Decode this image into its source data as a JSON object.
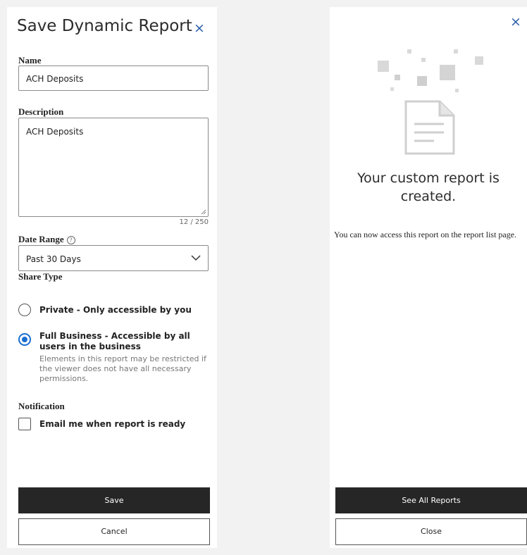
{
  "save_dialog": {
    "title": "Save Dynamic Report",
    "close_icon": "close-icon",
    "name": {
      "label": "Name",
      "value": "ACH Deposits"
    },
    "description": {
      "label": "Description",
      "value": "ACH Deposits",
      "counter": "12 / 250"
    },
    "date_range": {
      "label": "Date Range",
      "help_icon": "help-circle-icon",
      "selected": "Past 30 Days"
    },
    "share_type": {
      "label": "Share Type",
      "options": [
        {
          "label": "Private - Only accessible by you",
          "selected": false
        },
        {
          "label": "Full Business - Accessible by all users in the business",
          "selected": true,
          "hint": "Elements in this report may be restricted if the viewer does not have all necessary permissions."
        }
      ]
    },
    "notification": {
      "label": "Notification",
      "checkbox_label": "Email me when report is ready",
      "checked": false
    },
    "save_label": "Save",
    "cancel_label": "Cancel"
  },
  "success_dialog": {
    "close_icon": "close-icon",
    "illustration": "document-illustration",
    "title": "Your custom report is created.",
    "description": "You can now access this report on the report list page.",
    "see_all_label": "See All Reports",
    "close_label": "Close"
  },
  "colors": {
    "primary_button": "#262626",
    "radio_selected": "#1a6fd1",
    "close_icon": "#2b5fab",
    "illustration": "#cfcfcf"
  }
}
